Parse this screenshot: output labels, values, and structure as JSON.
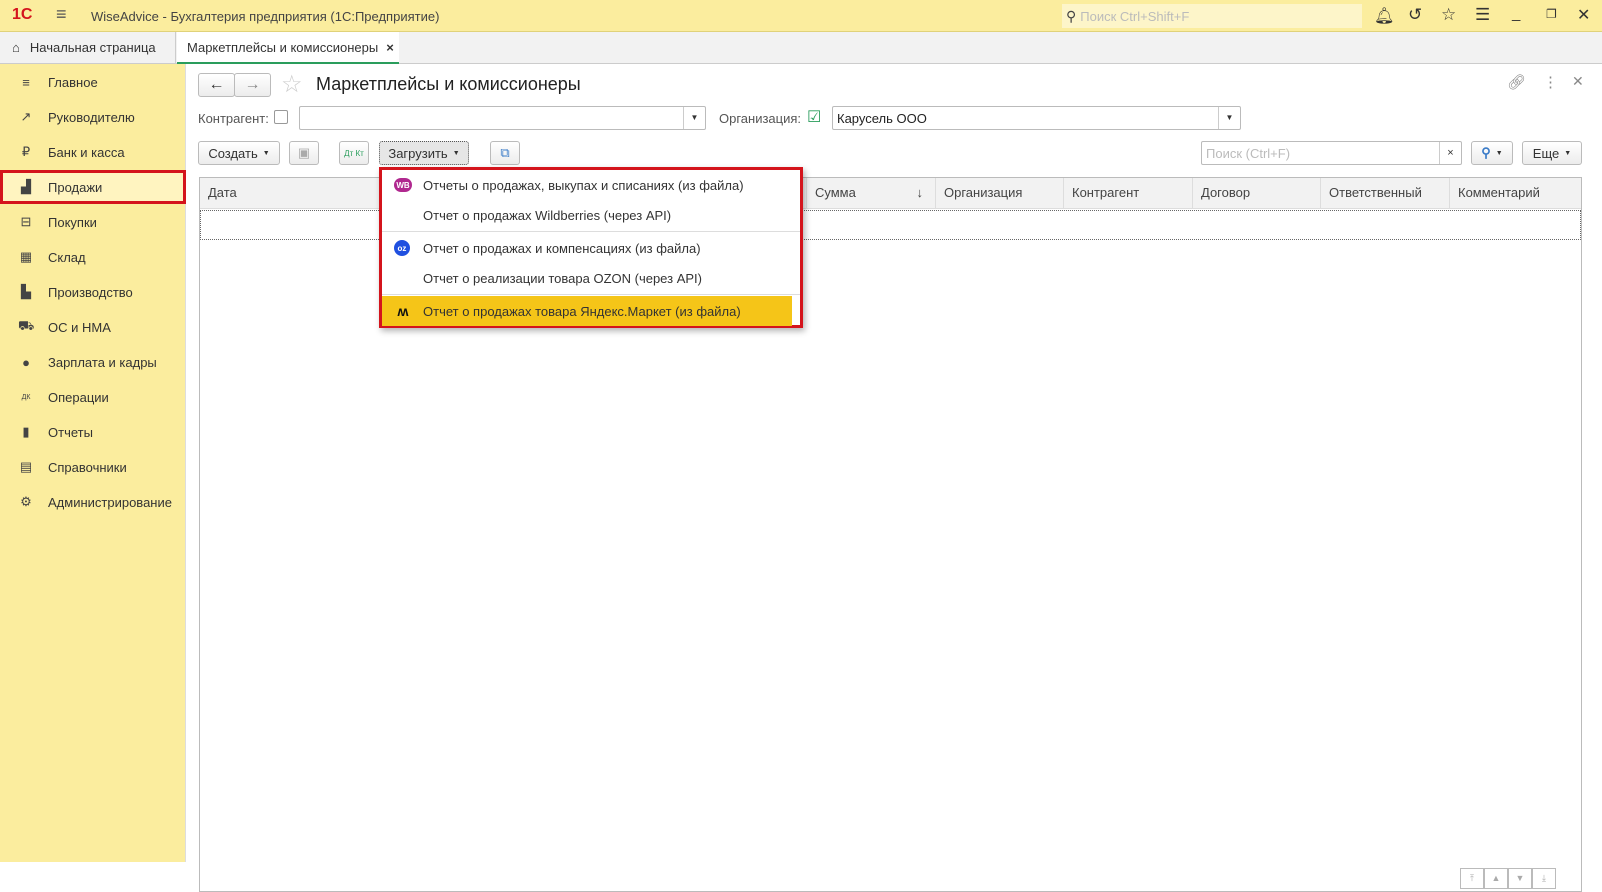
{
  "titlebar": {
    "title": "WiseAdvice - Бухгалтерия предприятия  (1С:Предприятие)",
    "search_placeholder": "Поиск Ctrl+Shift+F"
  },
  "tabs": [
    {
      "label": "Начальная страница"
    },
    {
      "label": "Маркетплейсы и комиссионеры",
      "close": "×"
    }
  ],
  "sidebar": {
    "items": [
      {
        "label": "Главное",
        "icon": "≡"
      },
      {
        "label": "Руководителю",
        "icon": "↗"
      },
      {
        "label": "Банк и касса",
        "icon": "₽"
      },
      {
        "label": "Продажи",
        "icon": "▟"
      },
      {
        "label": "Покупки",
        "icon": "⊟"
      },
      {
        "label": "Склад",
        "icon": "▦"
      },
      {
        "label": "Производство",
        "icon": "▙"
      },
      {
        "label": "ОС и НМА",
        "icon": "⛟"
      },
      {
        "label": "Зарплата и кадры",
        "icon": "●"
      },
      {
        "label": "Операции",
        "icon": "ДК"
      },
      {
        "label": "Отчеты",
        "icon": "▮"
      },
      {
        "label": "Справочники",
        "icon": "▤"
      },
      {
        "label": "Администрирование",
        "icon": "⚙"
      }
    ]
  },
  "page": {
    "title": "Маркетплейсы и комиссионеры",
    "filters": {
      "counterparty_label": "Контрагент:",
      "counterparty_value": "",
      "organization_label": "Организация:",
      "organization_value": "Карусель ООО"
    },
    "toolbar": {
      "create": "Создать",
      "load": "Загрузить",
      "search_placeholder": "Поиск (Ctrl+F)",
      "more": "Еще",
      "dtkt": "Дт Кт"
    },
    "columns": [
      "Дата",
      "Сумма",
      "Организация",
      "Контрагент",
      "Договор",
      "Ответственный",
      "Комментарий"
    ],
    "sort_indicator": "↓"
  },
  "load_menu": {
    "items": [
      {
        "label": "Отчеты о продажах, выкупах и списаниях (из файла)",
        "icon": "WB"
      },
      {
        "label": "Отчет о продажах Wildberries (через API)"
      },
      {
        "label": "Отчет о продажах и компенсациях (из файла)",
        "icon": "OZON"
      },
      {
        "label": "Отчет о реализации товара OZON (через API)"
      },
      {
        "label": "Отчет о продажах товара Яндекс.Маркет (из файла)",
        "icon": "YM"
      }
    ]
  },
  "colors": {
    "accent_yellow": "#fbed9e",
    "highlight": "#f5c518",
    "red_frame": "#d4141c"
  }
}
